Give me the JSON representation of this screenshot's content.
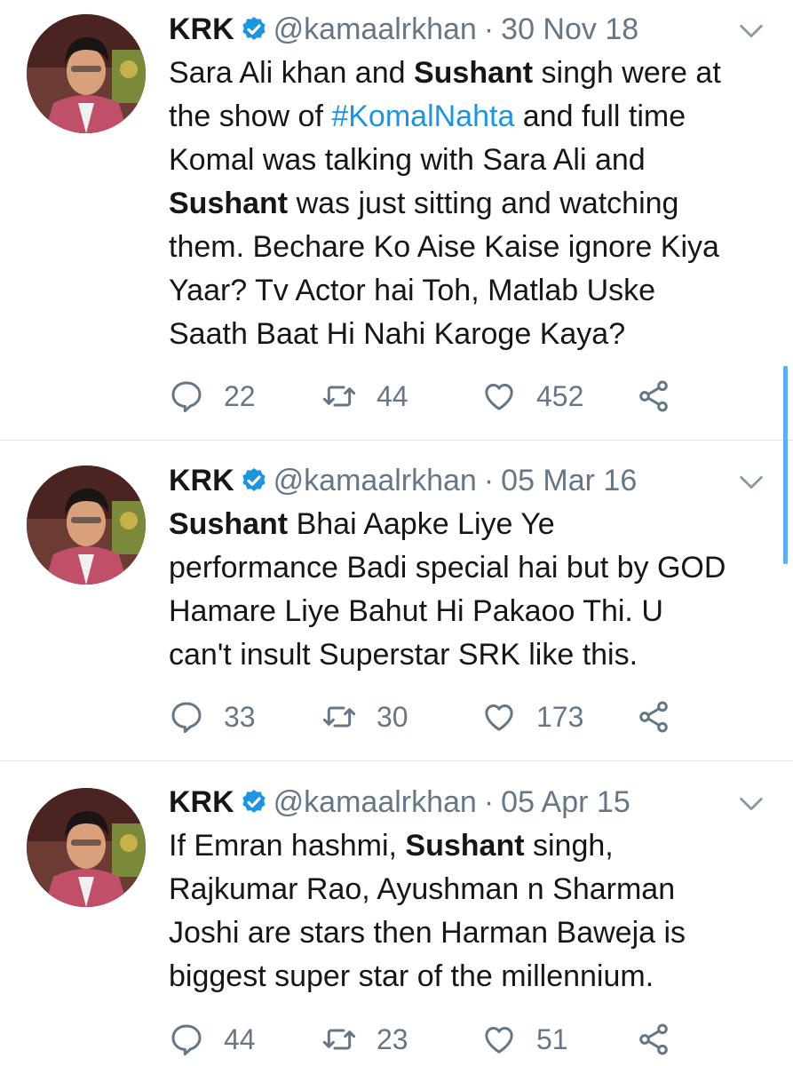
{
  "accent_color": "#1b95e0",
  "tweets": [
    {
      "name": "KRK",
      "verified_icon": "verified-badge-icon",
      "handle": "@kamaalrkhan",
      "separator": "·",
      "date": "30 Nov 18",
      "lines": [
        [
          {
            "t": "Sara Ali khan and "
          },
          {
            "t": "Sushant",
            "b": true
          },
          {
            "t": " singh were at"
          }
        ],
        [
          {
            "t": "the show of "
          },
          {
            "t": "#KomalNahta",
            "h": true
          },
          {
            "t": " and full time"
          }
        ],
        [
          {
            "t": "Komal was talking with Sara Ali and"
          }
        ],
        [
          {
            "t": "Sushant",
            "b": true
          },
          {
            "t": " was just sitting and watching"
          }
        ],
        [
          {
            "t": "them. Bechare Ko Aise Kaise ignore Kiya"
          }
        ],
        [
          {
            "t": "Yaar? Tv Actor hai Toh, Matlab Uske"
          }
        ],
        [
          {
            "t": "Saath Baat Hi Nahi Karoge Kaya?"
          }
        ]
      ],
      "replies": "22",
      "retweets": "44",
      "likes": "452"
    },
    {
      "name": "KRK",
      "verified_icon": "verified-badge-icon",
      "handle": "@kamaalrkhan",
      "separator": "·",
      "date": "05 Mar 16",
      "lines": [
        [
          {
            "t": "Sushant",
            "b": true
          },
          {
            "t": " Bhai Aapke Liye Ye"
          }
        ],
        [
          {
            "t": "performance Badi special hai but by GOD"
          }
        ],
        [
          {
            "t": "Hamare Liye Bahut Hi Pakaoo Thi. U"
          }
        ],
        [
          {
            "t": "can't insult Superstar SRK like this."
          }
        ]
      ],
      "replies": "33",
      "retweets": "30",
      "likes": "173"
    },
    {
      "name": "KRK",
      "verified_icon": "verified-badge-icon",
      "handle": "@kamaalrkhan",
      "separator": "·",
      "date": "05 Apr 15",
      "lines": [
        [
          {
            "t": "If Emran hashmi, "
          },
          {
            "t": "Sushant",
            "b": true
          },
          {
            "t": " singh,"
          }
        ],
        [
          {
            "t": "Rajkumar Rao, Ayushman n Sharman"
          }
        ],
        [
          {
            "t": "Joshi are stars then Harman Baweja is"
          }
        ],
        [
          {
            "t": "biggest super star of the millennium."
          }
        ]
      ],
      "replies": "44",
      "retweets": "23",
      "likes": "51"
    }
  ]
}
